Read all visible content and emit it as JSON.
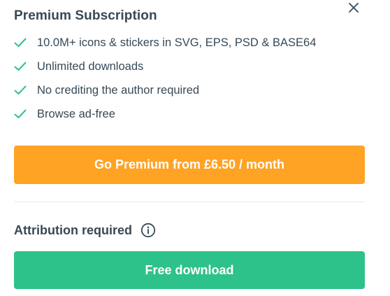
{
  "premium": {
    "title": "Premium Subscription",
    "features": [
      "10.0M+ icons & stickers in SVG, EPS, PSD & BASE64",
      "Unlimited downloads",
      "No crediting the author required",
      "Browse ad-free"
    ],
    "cta_label": "Go Premium from £6.50 / month",
    "cta_color": "#ffa325"
  },
  "attribution": {
    "title": "Attribution required",
    "download_label": "Free download",
    "download_color": "#2dc289"
  },
  "icons": {
    "close": "close-icon",
    "check": "check-icon",
    "info": "info-icon"
  },
  "colors": {
    "text": "#374957",
    "check": "#2dc289",
    "divider": "#e6e9ec"
  }
}
